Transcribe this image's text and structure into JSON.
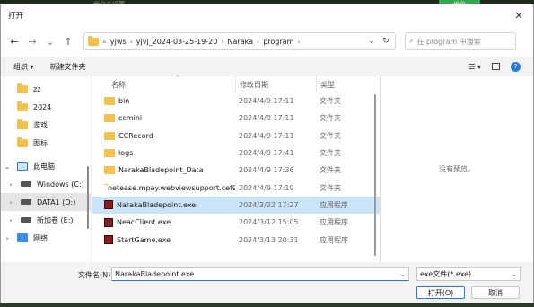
{
  "background": {
    "text": "优化未设置",
    "button": "优化"
  },
  "dialog": {
    "title": "打开",
    "close": "✕"
  },
  "nav": {
    "back": "←",
    "forward": "→",
    "recent": "⌄",
    "up": "↑",
    "breadcrumb_prefix": "«",
    "path": [
      "yjws",
      "yjvj_2024-03-25-19-20",
      "Naraka",
      "program"
    ],
    "path_sep": "›",
    "search_placeholder": "在 program 中搜索"
  },
  "toolbar": {
    "organize": "组织 ▾",
    "new_folder": "新建文件夹"
  },
  "sidebar": {
    "folders": [
      {
        "label": "zz"
      },
      {
        "label": "2024"
      },
      {
        "label": "游戏"
      },
      {
        "label": "图标"
      }
    ],
    "this_pc": "此电脑",
    "drives": [
      {
        "label": "Windows (C:)"
      },
      {
        "label": "DATA1 (D:)"
      },
      {
        "label": "新加卷 (E:)"
      }
    ],
    "network": "网络"
  },
  "filelist": {
    "headers": {
      "name": "名称",
      "date": "修改日期",
      "type": "类型"
    },
    "rows": [
      {
        "name": "bin",
        "date": "2024/4/9 17:11",
        "type": "文件夹",
        "kind": "folder"
      },
      {
        "name": "ccmini",
        "date": "2024/4/9 17:11",
        "type": "文件夹",
        "kind": "folder"
      },
      {
        "name": "CCRecord",
        "date": "2024/4/9 17:11",
        "type": "文件夹",
        "kind": "folder"
      },
      {
        "name": "logs",
        "date": "2024/4/9 17:41",
        "type": "文件夹",
        "kind": "folder"
      },
      {
        "name": "NarakaBladepoint_Data",
        "date": "2024/4/9 17:36",
        "type": "文件夹",
        "kind": "folder"
      },
      {
        "name": "netease.mpay.webviewsupport.cef90...",
        "date": "2024/4/9 17:19",
        "type": "文件夹",
        "kind": "folder"
      },
      {
        "name": "NarakaBladepoint.exe",
        "date": "2024/3/22 17:27",
        "type": "应用程序",
        "kind": "exe",
        "selected": true
      },
      {
        "name": "NeacClient.exe",
        "date": "2024/3/12 15:05",
        "type": "应用程序",
        "kind": "exe2"
      },
      {
        "name": "StartGame.exe",
        "date": "2024/3/13 20:31",
        "type": "应用程序",
        "kind": "exe"
      }
    ]
  },
  "preview": {
    "text": "没有预览。"
  },
  "footer": {
    "filename_label": "文件名(N):",
    "filename_value": "NarakaBladepoint.exe",
    "filter_value": "exe文件(*.exe)",
    "open_button": "打开(O)",
    "cancel_button": "取消"
  },
  "colors": {
    "selection": "#cce4f7",
    "accent": "#2b79d6",
    "folder": "#f2c14e"
  }
}
